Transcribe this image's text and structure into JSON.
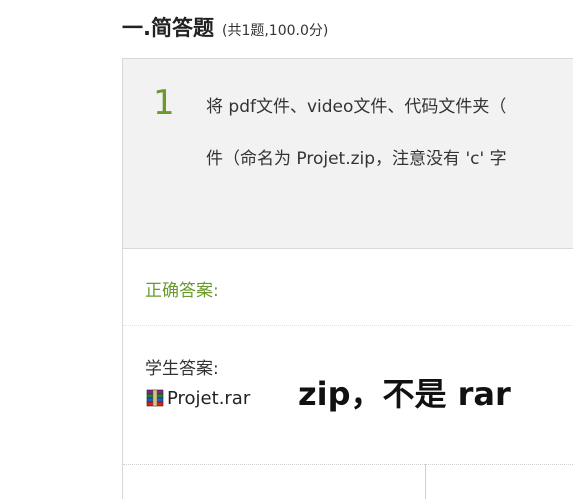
{
  "section": {
    "title": "一.简答题",
    "subtitle": "(共1题,100.0分)"
  },
  "question": {
    "number": "1",
    "line1": "将 pdf文件、video文件、代码文件夹（",
    "line2": "件（命名为 Projet.zip，注意没有 'c' 字"
  },
  "answer": {
    "correct_label": "正确答案:",
    "student_label": "学生答案:",
    "file_name": "Projet.rar",
    "file_icon": "winrar-archive-icon"
  },
  "annotation": {
    "comment": "zip，不是 rar",
    "highlight_color": "#f28b8b"
  },
  "colors": {
    "accent_green": "#6a9a2e",
    "question_bg": "#f2f2f2"
  }
}
